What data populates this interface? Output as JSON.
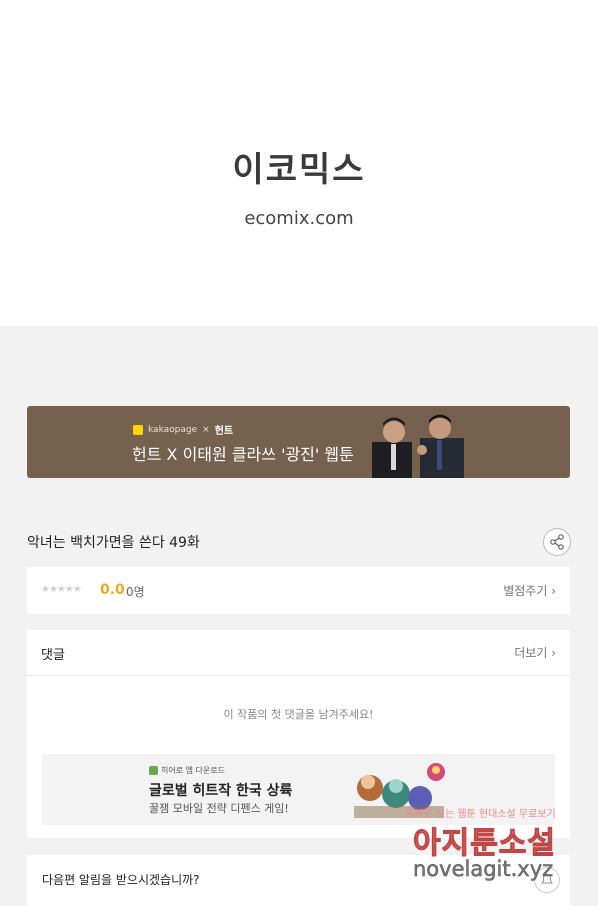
{
  "header": {
    "logo_text": "이코믹스",
    "domain": "ecomix.com"
  },
  "banner": {
    "brand_small": "kakaopage",
    "brand_separator": "×",
    "brand_hunt": "헌트",
    "title": "헌트 X 이태원 클라쓰 '광진' 웹툰"
  },
  "episode": {
    "title": "악녀는 백치가면을 쓴다 49화"
  },
  "rating": {
    "stars": "★★★★★",
    "score": "0.0",
    "people": "0명",
    "rate_link": "별점주기 ›"
  },
  "comments": {
    "title": "댓글",
    "more": "더보기 ›",
    "empty_message": "이 작품의 첫 댓글을 남겨주세요!",
    "ad": {
      "small": "히어로 엠 다운로드",
      "headline": "글로벌 히트작 한국 상륙",
      "sub": "꿀잼 모바일 전략 디펜스 게임!"
    }
  },
  "notify": {
    "question": "다음편 알림을 받으시겠습니까?"
  },
  "watermark": {
    "line1": "공짜로 보는 웹툰 현대소설 무료보기",
    "main": "아지툰소설",
    "url": "novelagit.xyz"
  },
  "colors": {
    "banner_bg": "#76604e",
    "score": "#f5a623",
    "watermark": "#e66b6b"
  }
}
